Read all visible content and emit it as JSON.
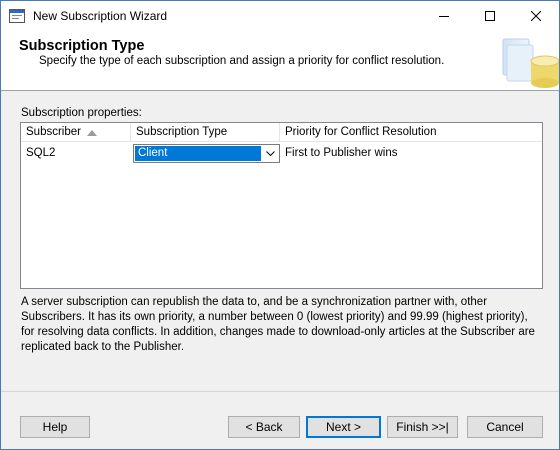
{
  "window": {
    "title": "New Subscription Wizard",
    "icon": "wizard-icon",
    "controls": [
      "minimize-icon",
      "maximize-icon",
      "close-icon"
    ]
  },
  "header": {
    "title": "Subscription Type",
    "subtitle": "Specify the type of each subscription and assign a priority for conflict resolution."
  },
  "grid": {
    "label": "Subscription properties:",
    "columns": [
      "Subscriber",
      "Subscription Type",
      "Priority for Conflict Resolution"
    ],
    "rows": [
      {
        "subscriber": "SQL2",
        "type": "Client",
        "priority": "First to Publisher wins"
      }
    ]
  },
  "description": "A server subscription can republish the data to, and be a synchronization partner with, other Subscribers. It has its own priority, a number between 0 (lowest priority) and 99.99 (highest priority), for resolving data conflicts. In addition, changes made to download-only articles at the Subscriber are replicated back to the Publisher.",
  "buttons": {
    "help": "Help",
    "back": "< Back",
    "next": "Next >",
    "finish": "Finish >>|",
    "cancel": "Cancel"
  },
  "colors": {
    "selection": "#0078d7",
    "window_border": "#4a7ab5"
  }
}
